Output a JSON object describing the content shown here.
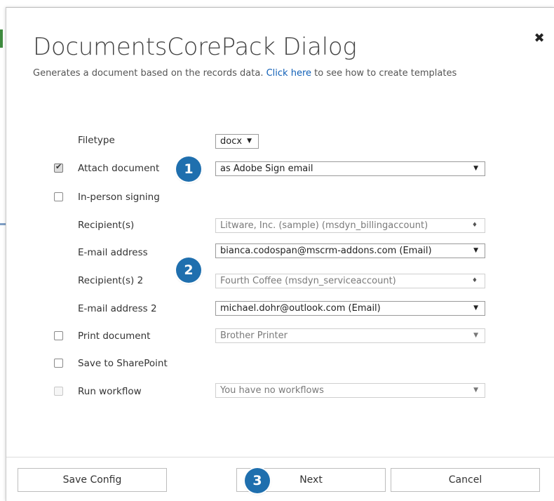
{
  "dialog": {
    "title": "DocumentsCorePack Dialog",
    "subtitle_pre": "Generates a document based on the records data.",
    "subtitle_link": "Click here",
    "subtitle_post": "to see how to create templates",
    "close_icon": "close-icon"
  },
  "form": {
    "filetype_label": "Filetype",
    "filetype_value": "docx",
    "attach_label": "Attach document",
    "attach_checked": true,
    "attach_value": "as Adobe Sign email",
    "inperson_label": "In-person signing",
    "inperson_checked": false,
    "recipient1_label": "Recipient(s)",
    "recipient1_value": "Litware, Inc. (sample) (msdyn_billingaccount)",
    "email1_label": "E-mail address",
    "email1_value": "bianca.codospan@mscrm-addons.com (Email)",
    "recipient2_label": "Recipient(s) 2",
    "recipient2_value": "Fourth Coffee (msdyn_serviceaccount)",
    "email2_label": "E-mail address 2",
    "email2_value": "michael.dohr@outlook.com (Email)",
    "print_label": "Print document",
    "print_checked": false,
    "print_value": "Brother Printer",
    "sharepoint_label": "Save to SharePoint",
    "sharepoint_checked": false,
    "workflow_label": "Run workflow",
    "workflow_checked": false,
    "workflow_value": "You have no workflows"
  },
  "badges": {
    "b1": "1",
    "b2": "2",
    "b3": "3"
  },
  "buttons": {
    "save_config": "Save Config",
    "next": "Next",
    "cancel": "Cancel"
  },
  "colors": {
    "badge": "#1f6fae",
    "link": "#1160b7"
  }
}
